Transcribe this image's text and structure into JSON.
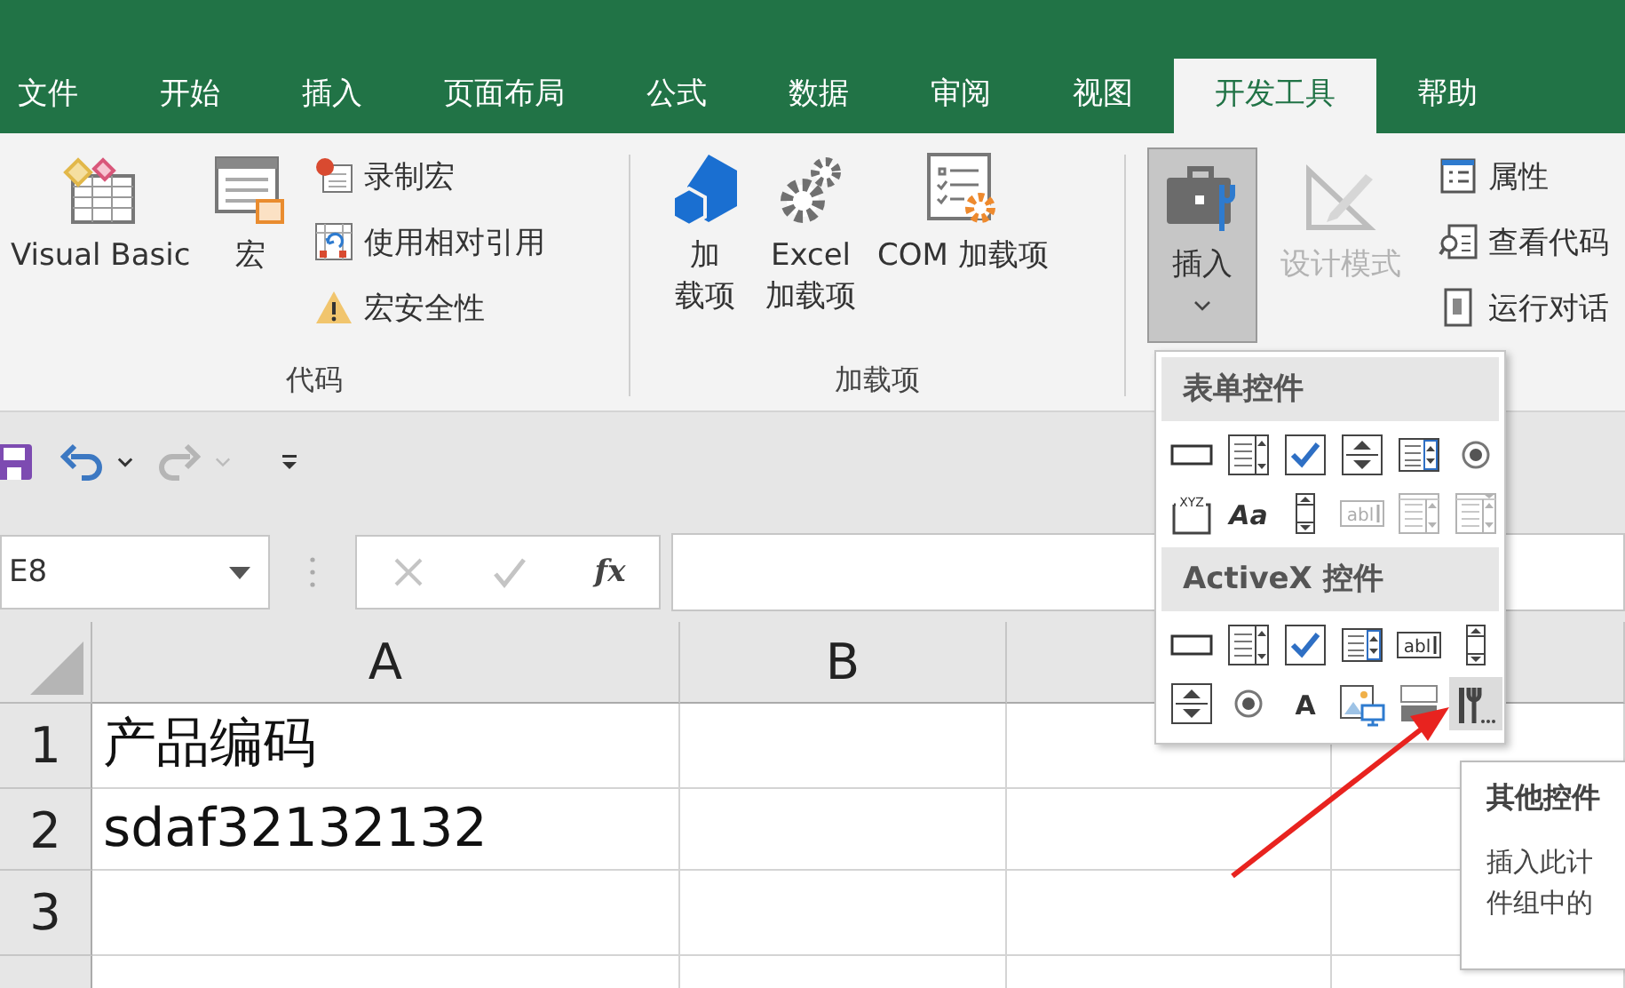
{
  "tabs": [
    {
      "label": "文件",
      "selected": false
    },
    {
      "label": "开始",
      "selected": false
    },
    {
      "label": "插入",
      "selected": false
    },
    {
      "label": "页面布局",
      "selected": false
    },
    {
      "label": "公式",
      "selected": false
    },
    {
      "label": "数据",
      "selected": false
    },
    {
      "label": "审阅",
      "selected": false
    },
    {
      "label": "视图",
      "selected": false
    },
    {
      "label": "开发工具",
      "selected": true
    },
    {
      "label": "帮助",
      "selected": false
    }
  ],
  "ribbon": {
    "groups": [
      {
        "label": "代码",
        "large": [
          {
            "lines": [
              "Visual Basic"
            ]
          },
          {
            "lines": [
              "宏"
            ]
          }
        ],
        "small": [
          {
            "label": "录制宏"
          },
          {
            "label": "使用相对引用"
          },
          {
            "label": "宏安全性"
          }
        ]
      },
      {
        "label": "加载项",
        "large": [
          {
            "lines": [
              "加",
              "载项"
            ]
          },
          {
            "lines": [
              "Excel",
              "加载项"
            ]
          },
          {
            "lines": [
              "COM 加载项"
            ]
          }
        ]
      },
      {
        "large": [
          {
            "lines": [
              "插入"
            ],
            "pressed": true,
            "disabled": false,
            "dropdown": true
          },
          {
            "lines": [
              "设计模式"
            ],
            "pressed": false,
            "disabled": true,
            "dropdown": false
          }
        ],
        "small": [
          {
            "label": "属性"
          },
          {
            "label": "查看代码"
          },
          {
            "label": "运行对话"
          }
        ]
      }
    ]
  },
  "quick_access": {
    "redo_disabled": true
  },
  "formula_bar": {
    "name_box": "E8",
    "function_label": "fx"
  },
  "sheet": {
    "columns": [
      "A",
      "B"
    ],
    "rows": [
      {
        "number": "1",
        "cells": [
          "产品编码"
        ]
      },
      {
        "number": "2",
        "cells": [
          "sdaf32132132"
        ]
      },
      {
        "number": "3"
      }
    ]
  },
  "insert_menu": {
    "sections": [
      {
        "title": "表单控件",
        "controls": [
          {
            "kind": "button",
            "disabled": false,
            "hovered": false
          },
          {
            "kind": "combo",
            "disabled": false,
            "hovered": false
          },
          {
            "kind": "checkbox",
            "disabled": false,
            "hovered": false
          },
          {
            "kind": "spin",
            "disabled": false,
            "hovered": false
          },
          {
            "kind": "listbox",
            "disabled": false,
            "hovered": false
          },
          {
            "kind": "radio",
            "disabled": false,
            "hovered": false
          },
          {
            "kind": "groupbox",
            "glyph": "XYZ",
            "disabled": false,
            "hovered": false
          },
          {
            "kind": "label",
            "glyph": "Aa",
            "disabled": false,
            "hovered": false
          },
          {
            "kind": "scrollbar",
            "disabled": false,
            "hovered": false
          },
          {
            "kind": "textfield",
            "glyph": "abl",
            "disabled": true,
            "hovered": false
          },
          {
            "kind": "combolist",
            "disabled": true,
            "hovered": false
          },
          {
            "kind": "combodrop",
            "disabled": true,
            "hovered": false
          }
        ]
      },
      {
        "title": "ActiveX 控件",
        "controls": [
          {
            "kind": "button",
            "disabled": false,
            "hovered": false
          },
          {
            "kind": "combo",
            "disabled": false,
            "hovered": false
          },
          {
            "kind": "checkbox",
            "disabled": false,
            "hovered": false
          },
          {
            "kind": "listbox",
            "disabled": false,
            "hovered": false
          },
          {
            "kind": "textfield",
            "glyph": "abl",
            "disabled": false,
            "hovered": false
          },
          {
            "kind": "scrollbar",
            "disabled": false,
            "hovered": false
          },
          {
            "kind": "spin",
            "disabled": false,
            "hovered": false
          },
          {
            "kind": "radio",
            "disabled": false,
            "hovered": false
          },
          {
            "kind": "label",
            "glyph": "A",
            "disabled": false,
            "hovered": false
          },
          {
            "kind": "image",
            "disabled": false,
            "hovered": false
          },
          {
            "kind": "toggle",
            "disabled": false,
            "hovered": false
          },
          {
            "kind": "more",
            "disabled": false,
            "hovered": true
          }
        ]
      }
    ]
  },
  "tooltip": {
    "title": "其他控件",
    "lines": [
      "插入此计",
      "件组中的"
    ]
  }
}
